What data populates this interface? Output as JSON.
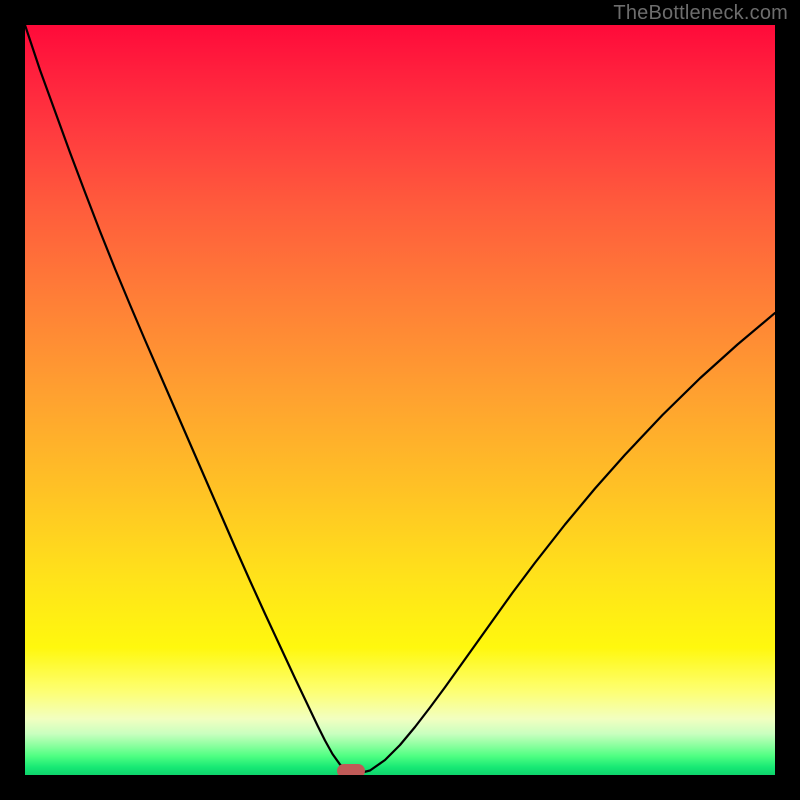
{
  "watermark": "TheBottleneck.com",
  "colors": {
    "frame": "#000000",
    "curve": "#000000",
    "marker": "#c05a57"
  },
  "chart_data": {
    "type": "line",
    "title": "",
    "xlabel": "",
    "ylabel": "",
    "xlim": [
      0,
      100
    ],
    "ylim": [
      0,
      100
    ],
    "grid": false,
    "legend": false,
    "series": [
      {
        "name": "bottleneck-curve",
        "x": [
          0,
          2,
          4,
          6,
          8,
          10,
          12,
          14,
          16,
          18,
          20,
          22,
          24,
          26,
          28,
          30,
          32,
          34,
          36,
          37,
          38,
          39,
          40,
          41,
          42,
          43,
          44,
          46,
          48,
          50,
          52,
          54,
          56,
          58,
          60,
          62,
          65,
          68,
          72,
          76,
          80,
          85,
          90,
          95,
          100
        ],
        "y": [
          100,
          94,
          88.5,
          83,
          77.7,
          72.5,
          67.5,
          62.7,
          58,
          53.4,
          48.8,
          44.2,
          39.6,
          35,
          30.4,
          25.9,
          21.5,
          17.2,
          12.9,
          10.8,
          8.7,
          6.6,
          4.6,
          2.8,
          1.4,
          0.6,
          0.1,
          0.6,
          2,
          4,
          6.4,
          9,
          11.7,
          14.5,
          17.3,
          20.1,
          24.3,
          28.3,
          33.4,
          38.2,
          42.7,
          48,
          52.9,
          57.4,
          61.6
        ]
      }
    ],
    "marker": {
      "x": 43.5,
      "y": 0.5
    },
    "background_gradient": {
      "orientation": "vertical",
      "stops": [
        {
          "pos": 0.0,
          "color": "#ff0a3a"
        },
        {
          "pos": 0.25,
          "color": "#ff5b3c"
        },
        {
          "pos": 0.5,
          "color": "#ffa030"
        },
        {
          "pos": 0.75,
          "color": "#ffe31a"
        },
        {
          "pos": 0.9,
          "color": "#fdff76"
        },
        {
          "pos": 0.96,
          "color": "#8effa0"
        },
        {
          "pos": 1.0,
          "color": "#0fd36c"
        }
      ]
    }
  }
}
